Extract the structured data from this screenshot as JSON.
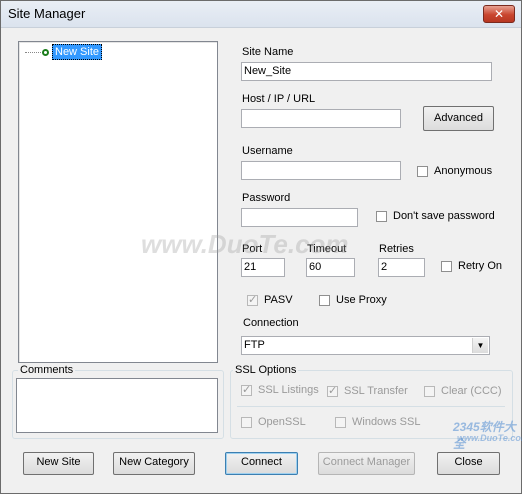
{
  "window": {
    "title": "Site Manager",
    "close_glyph": "✕"
  },
  "tree": {
    "item_label": "New Site"
  },
  "fields": {
    "site_name": {
      "label": "Site Name",
      "value": "New_Site"
    },
    "host": {
      "label": "Host / IP / URL",
      "value": ""
    },
    "advanced_button": "Advanced",
    "username": {
      "label": "Username",
      "value": ""
    },
    "anonymous": "Anonymous",
    "password": {
      "label": "Password",
      "value": ""
    },
    "dont_save_password": "Don't save password",
    "port": {
      "label": "Port",
      "value": "21"
    },
    "timeout": {
      "label": "Timeout",
      "value": "60"
    },
    "retries": {
      "label": "Retries",
      "value": "2"
    },
    "retry_on": "Retry On",
    "pasv": {
      "label": "PASV",
      "checked": true
    },
    "use_proxy": {
      "label": "Use Proxy",
      "checked": false
    },
    "connection": {
      "label": "Connection",
      "value": "FTP"
    }
  },
  "comments": {
    "label": "Comments",
    "value": ""
  },
  "ssl": {
    "title": "SSL Options",
    "ssl_listings": "SSL Listings",
    "ssl_transfer": "SSL Transfer",
    "clear_ccc": "Clear (CCC)",
    "openssl": "OpenSSL",
    "windows_ssl": "Windows SSL"
  },
  "buttons": {
    "new_site": "New Site",
    "new_category": "New Category",
    "connect": "Connect",
    "connect_manager": "Connect Manager",
    "close": "Close"
  },
  "watermark": {
    "left": "www.DuoTe.com",
    "right": "2345软件大全",
    "right_url": "www.DuoTe.com"
  }
}
